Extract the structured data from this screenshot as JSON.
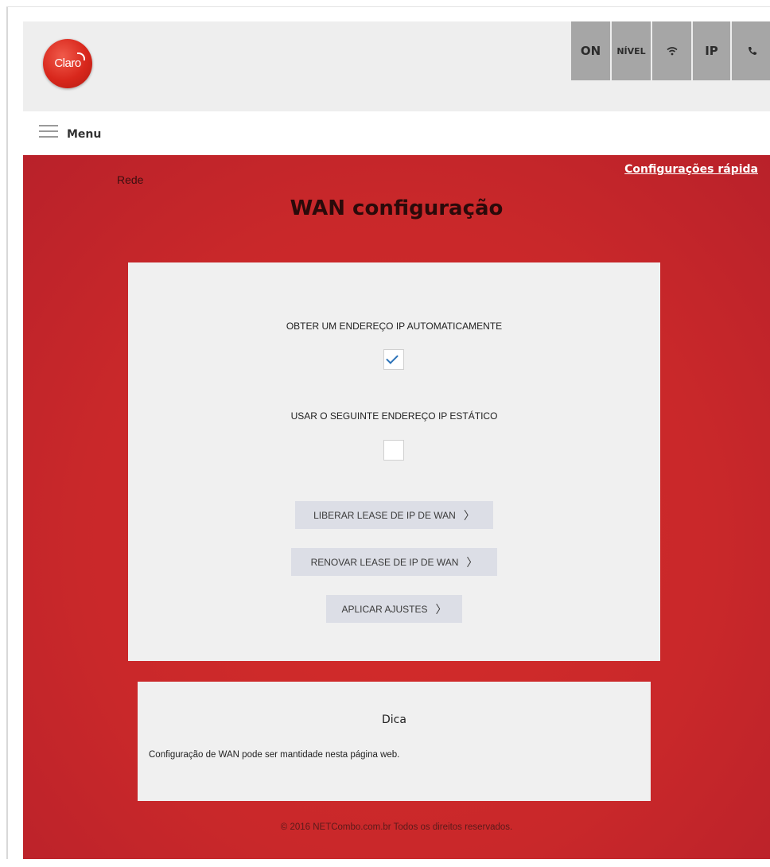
{
  "header": {
    "logo_text": "Claro",
    "status_buttons": {
      "on": "ON",
      "nivel": "NÍVEL",
      "ip": "IP"
    }
  },
  "menu": {
    "label": "Menu"
  },
  "main": {
    "breadcrumb": "Rede",
    "quick_settings_link": "Configurações rápida",
    "title": "WAN configuração"
  },
  "form": {
    "auto_ip_label": "OBTER UM ENDEREÇO IP AUTOMATICAMENTE",
    "auto_ip_checked": true,
    "static_ip_label": "USAR O SEGUINTE ENDEREÇO IP ESTÁTICO",
    "static_ip_checked": false,
    "release_button": "LIBERAR LEASE DE IP DE WAN",
    "renew_button": "RENOVAR LEASE DE IP DE WAN",
    "apply_button": "APLICAR AJUSTES"
  },
  "tip": {
    "title": "Dica",
    "text": "Configuração de WAN pode ser mantidade nesta página web."
  },
  "footer": {
    "text": "© 2016 NETCombo.com.br Todos os direitos reservados."
  },
  "colors": {
    "brand_red": "#c9282a",
    "panel_gray": "#f0f0f0",
    "status_gray": "#a6a6a6",
    "button_bg": "#dcdee6",
    "check_blue": "#2b72b8"
  },
  "icons": [
    "claro-logo",
    "hamburger-icon",
    "wifi-icon",
    "phone-icon",
    "check-icon",
    "chevron-right-icon"
  ]
}
